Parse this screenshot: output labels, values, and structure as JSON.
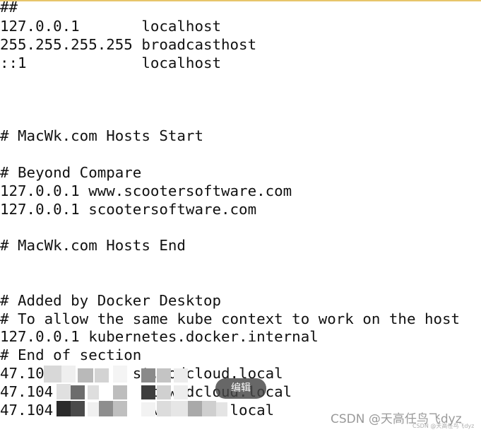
{
  "lines": [
    "##",
    "127.0.0.1       localhost",
    "255.255.255.255 broadcasthost",
    "::1             localhost",
    "",
    "",
    "",
    "# MacWk.com Hosts Start",
    "",
    "# Beyond Compare",
    "127.0.0.1 www.scootersoftware.com",
    "127.0.0.1 scootersoftware.com",
    "",
    "# MacWk.com Hosts End",
    "",
    "",
    "# Added by Docker Desktop",
    "# To allow the same kube context to work on the host",
    "127.0.0.1 kubernetes.docker.internal",
    "# End of section",
    "47.10          st.wodcloud.local",
    "47.104          st.wodcloud.local",
    "47.104          .wodcloud.local"
  ],
  "overlay": {
    "edit_label": "编辑"
  },
  "watermark": {
    "main": "CSDN @天高任鸟飞dyz",
    "small": "CSDN @天高任鸟飞dyz"
  },
  "colors": {
    "text": "#111111",
    "background": "#ffffff",
    "pill": "#464646"
  }
}
